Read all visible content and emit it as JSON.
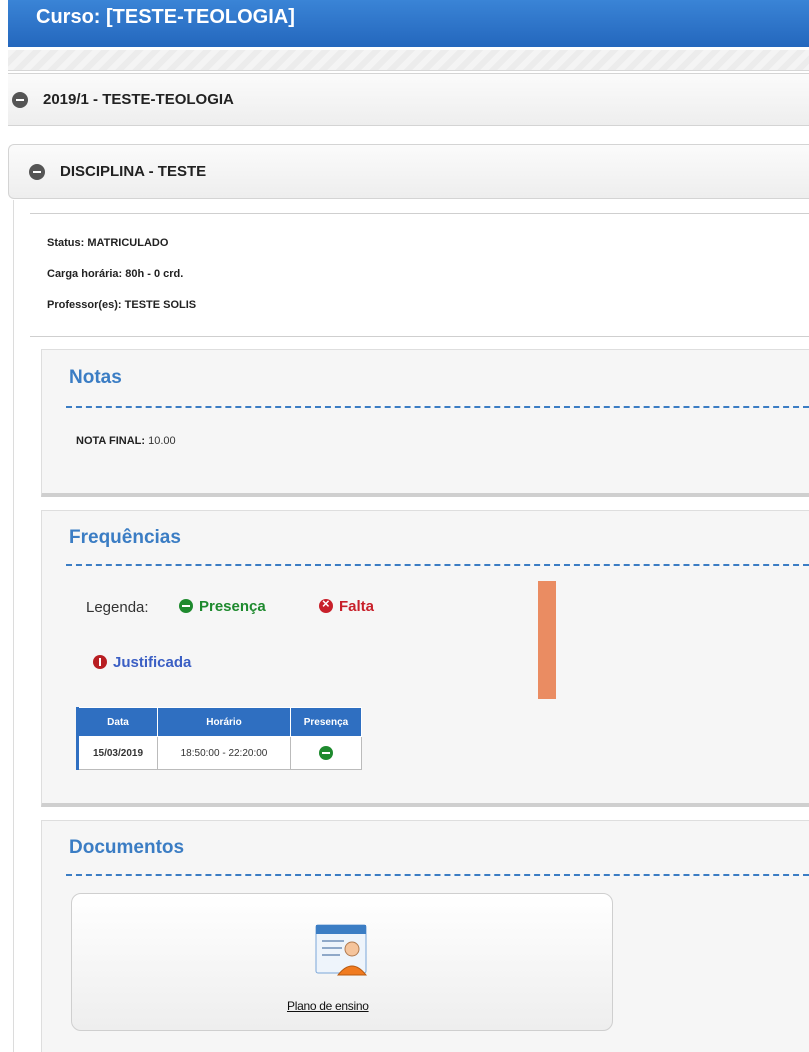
{
  "header": {
    "title": "Curso: [TESTE-TEOLOGIA]"
  },
  "period": {
    "label": "2019/1 - TESTE-TEOLOGIA"
  },
  "discipline": {
    "label": "DISCIPLINA - TESTE",
    "status": "Status: MATRICULADO",
    "workload": "Carga horária: 80h - 0 crd.",
    "professor": "Professor(es): TESTE SOLIS"
  },
  "notas": {
    "title": "Notas",
    "label": "NOTA FINAL:",
    "value": "10.00"
  },
  "frequencias": {
    "title": "Frequências",
    "legend_label": "Legenda:",
    "legend_presenca": "Presença",
    "legend_falta": "Falta",
    "legend_justificada": "Justificada",
    "table": {
      "headers": [
        "Data",
        "Horário",
        "Presença"
      ],
      "rows": [
        {
          "date": "15/03/2019",
          "time": "18:50:00 - 22:20:00",
          "status": "present"
        }
      ]
    }
  },
  "documentos": {
    "title": "Documentos",
    "item_label": "Plano de ensino",
    "item_icon": "document-teacher-icon"
  },
  "colors": {
    "brand_blue": "#2f6fc1",
    "presence_green": "#1e8a2e",
    "absence_red": "#c8202a",
    "justified_blue": "#3b5fc4"
  }
}
